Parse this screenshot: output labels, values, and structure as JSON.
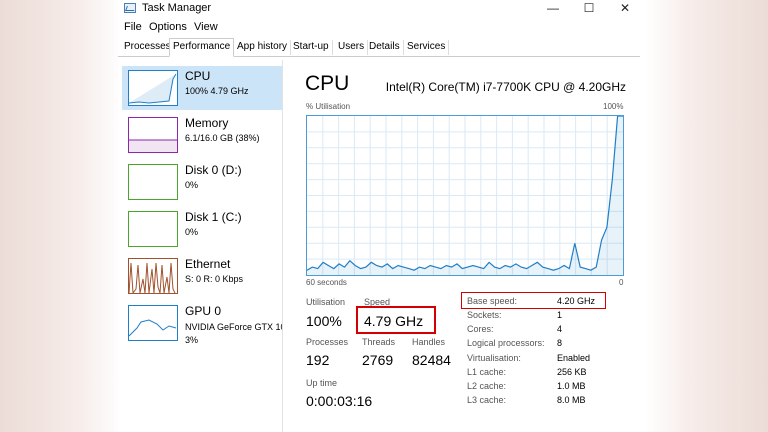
{
  "window": {
    "title": "Task Manager",
    "controls": [
      "—",
      "☐",
      "✕"
    ]
  },
  "menu": [
    "File",
    "Options",
    "View"
  ],
  "tabs": [
    "Processes",
    "Performance",
    "App history",
    "Start-up",
    "Users",
    "Details",
    "Services"
  ],
  "active_tab": "Performance",
  "sidebar": {
    "items": [
      {
        "name": "CPU",
        "sub": "100% 4.79 GHz",
        "color": "#1f7fc8"
      },
      {
        "name": "Memory",
        "sub": "6.1/16.0 GB (38%)",
        "color": "#8b27a8"
      },
      {
        "name": "Disk 0 (D:)",
        "sub": "0%",
        "color": "#4ca52b"
      },
      {
        "name": "Disk 1 (C:)",
        "sub": "0%",
        "color": "#4ca52b"
      },
      {
        "name": "Ethernet",
        "sub": "S: 0 R: 0 Kbps",
        "color": "#a0522d"
      },
      {
        "name": "GPU 0",
        "sub1": "NVIDIA GeForce GTX 10",
        "sub2": "3%",
        "color": "#1f7fc8"
      }
    ]
  },
  "cpu": {
    "title": "CPU",
    "model": "Intel(R) Core(TM) i7-7700K CPU @ 4.20GHz",
    "graph_label": "% Utilisation",
    "graph_max": "100%",
    "time_label": "60 seconds",
    "graph_min": "0",
    "utilisation_label": "Utilisation",
    "utilisation": "100%",
    "speed_label": "Speed",
    "speed": "4.79 GHz",
    "processes_label": "Processes",
    "processes": "192",
    "threads_label": "Threads",
    "threads": "2769",
    "handles_label": "Handles",
    "handles": "82484",
    "uptime_label": "Up time",
    "uptime": "0:00:03:16",
    "info": [
      {
        "k": "Base speed:",
        "v": "4.20 GHz"
      },
      {
        "k": "Sockets:",
        "v": "1"
      },
      {
        "k": "Cores:",
        "v": "4"
      },
      {
        "k": "Logical processors:",
        "v": "8"
      },
      {
        "k": "Virtualisation:",
        "v": "Enabled"
      },
      {
        "k": "L1 cache:",
        "v": "256 KB"
      },
      {
        "k": "L2 cache:",
        "v": "1.0 MB"
      },
      {
        "k": "L3 cache:",
        "v": "8.0 MB"
      }
    ],
    "utilisation_series": [
      3,
      5,
      4,
      8,
      6,
      4,
      7,
      5,
      9,
      6,
      4,
      5,
      8,
      6,
      5,
      7,
      4,
      6,
      5,
      4,
      3,
      5,
      4,
      6,
      5,
      4,
      6,
      5,
      7,
      4,
      5,
      6,
      5,
      4,
      8,
      5,
      4,
      6,
      5,
      7,
      5,
      4,
      6,
      8,
      5,
      4,
      3,
      4,
      6,
      4,
      20,
      5,
      4,
      3,
      5,
      22,
      30,
      60,
      100,
      100
    ]
  },
  "colors": {
    "accent": "#1f7fc8",
    "selected_bg": "#cce4f7",
    "highlight": "#d40000",
    "grid": "#d9eaf7"
  }
}
